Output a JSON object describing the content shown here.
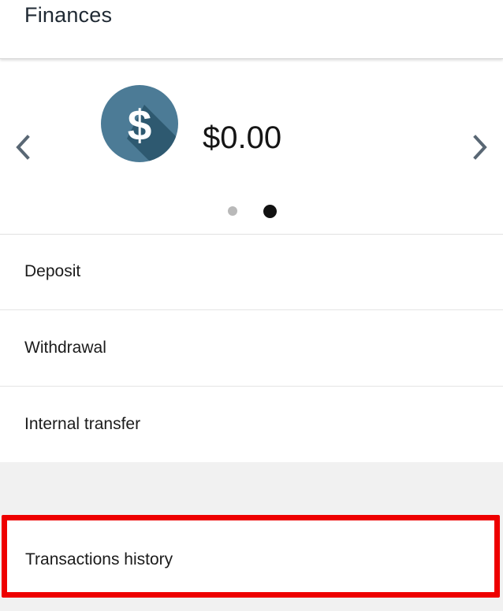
{
  "header": {
    "title": "Finances"
  },
  "balance": {
    "amount": "$0.00",
    "currency_icon": "dollar-coin-icon",
    "coin_color": "#4c7b96",
    "carousel": {
      "prev_icon": "chevron-left-icon",
      "next_icon": "chevron-right-icon",
      "total_pages": 2,
      "active_page": 2
    }
  },
  "menu": {
    "items": [
      {
        "label": "Deposit"
      },
      {
        "label": "Withdrawal"
      },
      {
        "label": "Internal transfer"
      }
    ]
  },
  "history": {
    "label": "Transactions history",
    "highlight_color": "#ee0000"
  }
}
